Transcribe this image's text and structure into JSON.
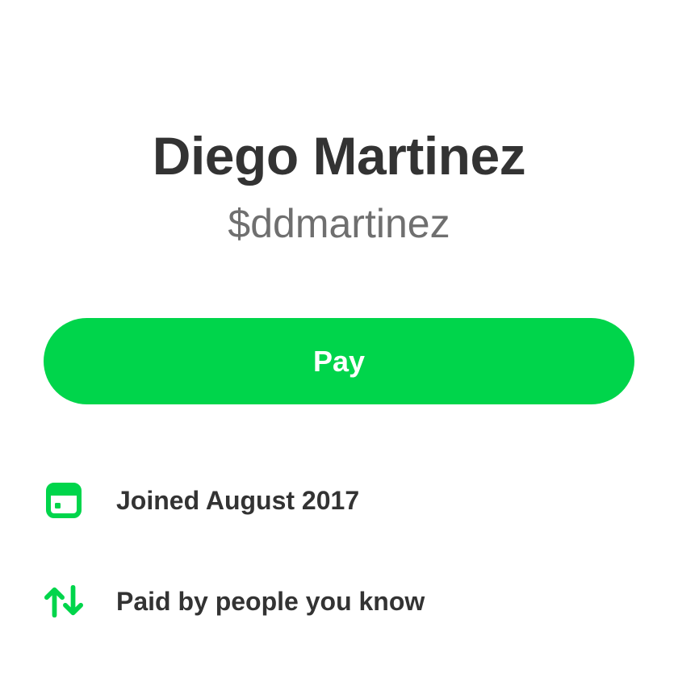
{
  "profile": {
    "name": "Diego Martinez",
    "handle": "$ddmartinez"
  },
  "actions": {
    "pay_label": "Pay"
  },
  "info": [
    {
      "icon": "calendar-card-icon",
      "text": "Joined August 2017"
    },
    {
      "icon": "transfer-arrows-icon",
      "text": "Paid by people you know"
    }
  ],
  "colors": {
    "accent": "#00d54b",
    "text_primary": "#333333",
    "text_secondary": "#6f6f6f",
    "background": "#ffffff"
  }
}
